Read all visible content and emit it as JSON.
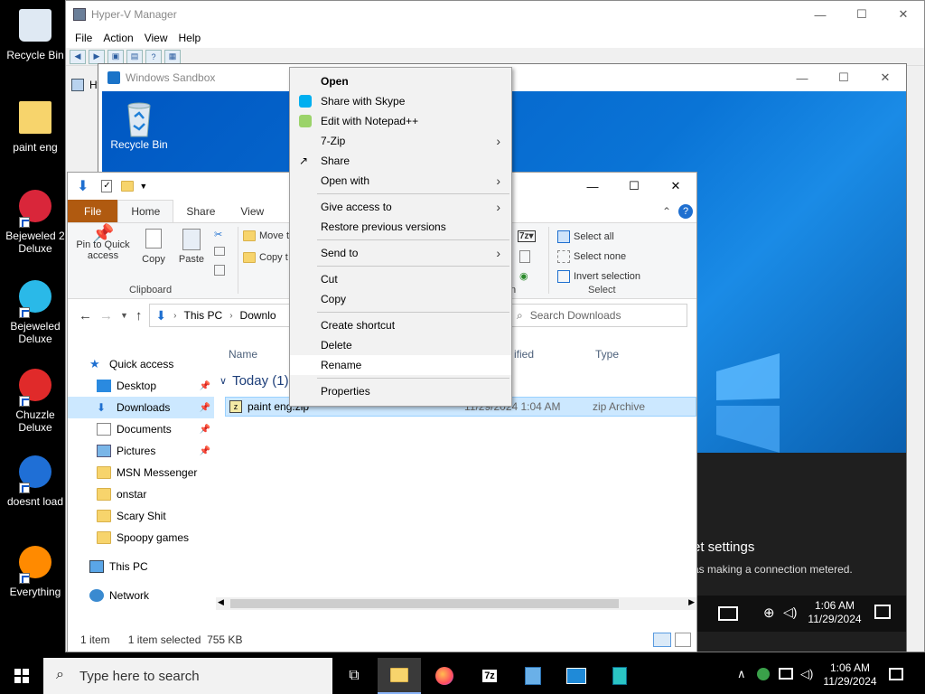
{
  "desktop_icons": [
    {
      "label": "Recycle Bin",
      "icon": "recycle-bin-icon"
    },
    {
      "label": "paint eng",
      "icon": "folder-icon"
    },
    {
      "label": "Bejeweled 2 Deluxe",
      "icon": "bejeweled2-icon"
    },
    {
      "label": "Bejeweled Deluxe",
      "icon": "bejeweled-icon"
    },
    {
      "label": "Chuzzle Deluxe",
      "icon": "chuzzle-icon"
    },
    {
      "label": "doesnt load",
      "icon": "thunderbird-icon"
    },
    {
      "label": "Everything",
      "icon": "everything-icon"
    }
  ],
  "hyperv": {
    "title": "Hyper-V Manager",
    "menu": [
      "File",
      "Action",
      "View",
      "Help"
    ],
    "tree_root": "Hyp"
  },
  "sandbox": {
    "title": "Windows Sandbox",
    "recycle_bin": "Recycle Bin",
    "net_title": "et settings",
    "net_text": "as making a connection metered.",
    "clock_time": "1:06 AM",
    "clock_date": "11/29/2024"
  },
  "explorer": {
    "tabs": [
      "File",
      "Home",
      "Share",
      "View"
    ],
    "clipboard": {
      "pin": "Pin to Quick access",
      "copy": "Copy",
      "paste": "Paste",
      "move": "Move t",
      "copyto": "Copy t",
      "label": "Clipboard"
    },
    "select": {
      "all": "Select all",
      "none": "Select none",
      "invert": "Invert selection",
      "label": "Select"
    },
    "open_label": "n",
    "path": [
      "This PC",
      "Downlo"
    ],
    "search_placeholder": "Search Downloads",
    "columns": {
      "name": "Name",
      "modified": "ified",
      "type": "Type"
    },
    "group": "Today (1)",
    "file": {
      "name": "paint eng.zip",
      "date": "11/29/2024 1:04 AM",
      "type": "zip Archive"
    },
    "nav": [
      {
        "label": "Quick access",
        "icon": "star-icon",
        "indent": 0,
        "pin": false
      },
      {
        "label": "Desktop",
        "icon": "desktop-icon",
        "indent": 1,
        "pin": true
      },
      {
        "label": "Downloads",
        "icon": "download-icon",
        "indent": 1,
        "pin": true,
        "selected": true
      },
      {
        "label": "Documents",
        "icon": "documents-icon",
        "indent": 1,
        "pin": true
      },
      {
        "label": "Pictures",
        "icon": "pictures-icon",
        "indent": 1,
        "pin": true
      },
      {
        "label": "MSN Messenger",
        "icon": "folder-icon",
        "indent": 1,
        "pin": false
      },
      {
        "label": "onstar",
        "icon": "folder-icon",
        "indent": 1,
        "pin": false
      },
      {
        "label": "Scary Shit",
        "icon": "folder-icon",
        "indent": 1,
        "pin": false
      },
      {
        "label": "Spoopy games",
        "icon": "folder-icon",
        "indent": 1,
        "pin": false
      },
      {
        "label": "This PC",
        "icon": "this-pc-icon",
        "indent": 0,
        "pin": false
      },
      {
        "label": "Network",
        "icon": "network-icon",
        "indent": 0,
        "pin": false
      }
    ],
    "status": {
      "count": "1 item",
      "selected": "1 item selected",
      "size": "755 KB"
    }
  },
  "context_menu": [
    {
      "label": "Open",
      "bold": true
    },
    {
      "label": "Share with Skype",
      "icon": "skype-icon"
    },
    {
      "label": "Edit with Notepad++",
      "icon": "notepadpp-icon"
    },
    {
      "label": "7-Zip",
      "submenu": true
    },
    {
      "label": "Share",
      "icon": "share-icon"
    },
    {
      "label": "Open with",
      "submenu": true
    },
    {
      "sep": true
    },
    {
      "label": "Give access to",
      "submenu": true
    },
    {
      "label": "Restore previous versions"
    },
    {
      "sep": true
    },
    {
      "label": "Send to",
      "submenu": true
    },
    {
      "sep": true
    },
    {
      "label": "Cut"
    },
    {
      "label": "Copy"
    },
    {
      "sep": true
    },
    {
      "label": "Create shortcut"
    },
    {
      "label": "Delete"
    },
    {
      "label": "Rename",
      "hover": true
    },
    {
      "sep": true
    },
    {
      "label": "Properties"
    }
  ],
  "taskbar": {
    "search_placeholder": "Type here to search",
    "time": "1:06 AM",
    "date": "11/29/2024"
  }
}
